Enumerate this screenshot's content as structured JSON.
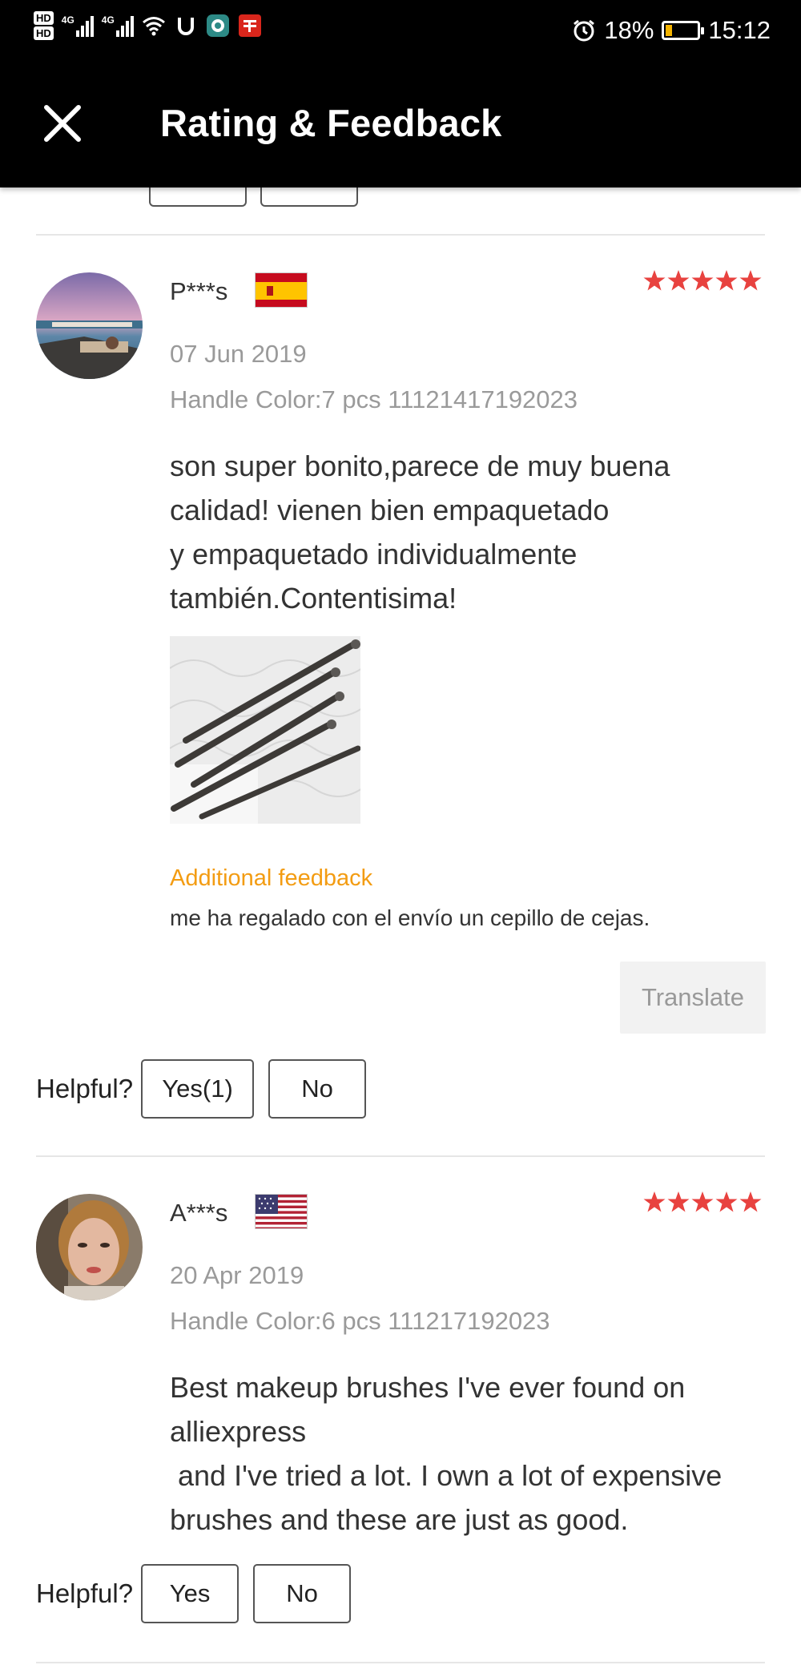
{
  "status_bar": {
    "network_1": "4G",
    "network_2": "4G",
    "hd_1": "HD",
    "hd_2": "HD",
    "battery_percent": "18%",
    "battery_level": 0.18,
    "time": "15:12",
    "icons": [
      "signal-icon",
      "wifi-icon",
      "u-icon",
      "app-icon",
      "notification-icon",
      "alarm-icon",
      "battery-icon"
    ]
  },
  "header": {
    "title": "Rating & Feedback",
    "close_icon": "close-icon"
  },
  "colors": {
    "header_bg": "#000000",
    "star": "#e8423f",
    "additional_feedback": "#f39c12",
    "meta_text": "#9a9a9a"
  },
  "reviews": [
    {
      "user": "P***s",
      "country": "Spain",
      "rating": 5,
      "date": "07 Jun 2019",
      "sku": "Handle Color:7 pcs 11121417192023",
      "text": "son super bonito,parece de muy buena\ncalidad! vienen bien empaquetado\ny empaquetado individualmente\ntambién.Contentisima!",
      "additional_feedback_title": "Additional feedback",
      "additional_feedback_text": "me ha regalado con el envío un cepillo de cejas.",
      "translate_label": "Translate",
      "helpful_label": "Helpful?",
      "yes_label": "Yes(1)",
      "no_label": "No"
    },
    {
      "user": "A***s",
      "country": "United States",
      "rating": 5,
      "date": "20 Apr 2019",
      "sku": "Handle Color:6 pcs 111217192023",
      "text": "Best makeup brushes I've ever found on\nalliexpress\n and I've tried a lot. I own a lot of expensive\nbrushes and these are just as good.",
      "helpful_label": "Helpful?",
      "yes_label": "Yes",
      "no_label": "No"
    }
  ]
}
